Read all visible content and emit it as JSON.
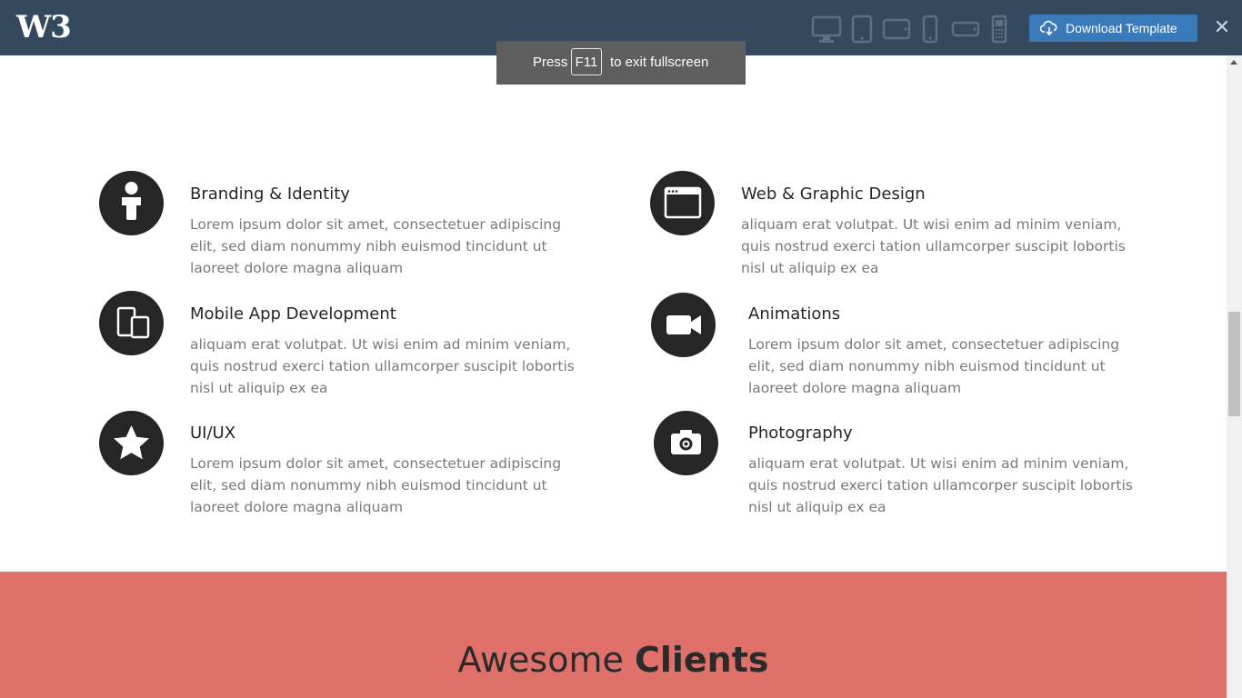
{
  "topbar": {
    "logo": "W3",
    "download_label": "Download Template",
    "close_glyph": "✕",
    "devices": [
      "desktop-icon",
      "tablet-portrait-icon",
      "tablet-landscape-icon",
      "phone-portrait-icon",
      "phone-landscape-icon",
      "feature-phone-icon"
    ]
  },
  "fullscreen_toast": {
    "before": "Press",
    "key": "F11",
    "after": "to exit fullscreen"
  },
  "services": [
    {
      "title": "Branding & Identity",
      "desc": "Lorem ipsum dolor sit amet, consectetuer adipiscing elit, sed diam nonummy nibh euismod tincidunt ut laoreet dolore magna aliquam",
      "icon": "person-icon"
    },
    {
      "title": "Web & Graphic Design",
      "desc": "aliquam erat volutpat. Ut wisi enim ad minim veniam, quis nostrud exerci tation ullamcorper suscipit lobortis nisl ut aliquip ex ea",
      "icon": "browser-window-icon"
    },
    {
      "title": "Mobile App Development",
      "desc": "aliquam erat volutpat. Ut wisi enim ad minim veniam, quis nostrud exerci tation ullamcorper suscipit lobortis nisl ut aliquip ex ea",
      "icon": "devices-icon"
    },
    {
      "title": "Animations",
      "desc": "Lorem ipsum dolor sit amet, consectetuer adipiscing elit, sed diam nonummy nibh euismod tincidunt ut laoreet dolore magna aliquam",
      "icon": "video-camera-icon"
    },
    {
      "title": "UI/UX",
      "desc": "Lorem ipsum dolor sit amet, consectetuer adipiscing elit, sed diam nonummy nibh euismod tincidunt ut laoreet dolore magna aliquam",
      "icon": "star-icon"
    },
    {
      "title": "Photography",
      "desc": "aliquam erat volutpat. Ut wisi enim ad minim veniam, quis nostrud exerci tation ullamcorper suscipit lobortis nisl ut aliquip ex ea",
      "icon": "camera-icon"
    }
  ],
  "clients": {
    "title_light": "Awesome",
    "title_bold": "Clients"
  },
  "colors": {
    "topbar": "#34495e",
    "accent_button": "#3a7ab8",
    "clients_band": "#e0716a",
    "icon_circle": "#262626"
  }
}
